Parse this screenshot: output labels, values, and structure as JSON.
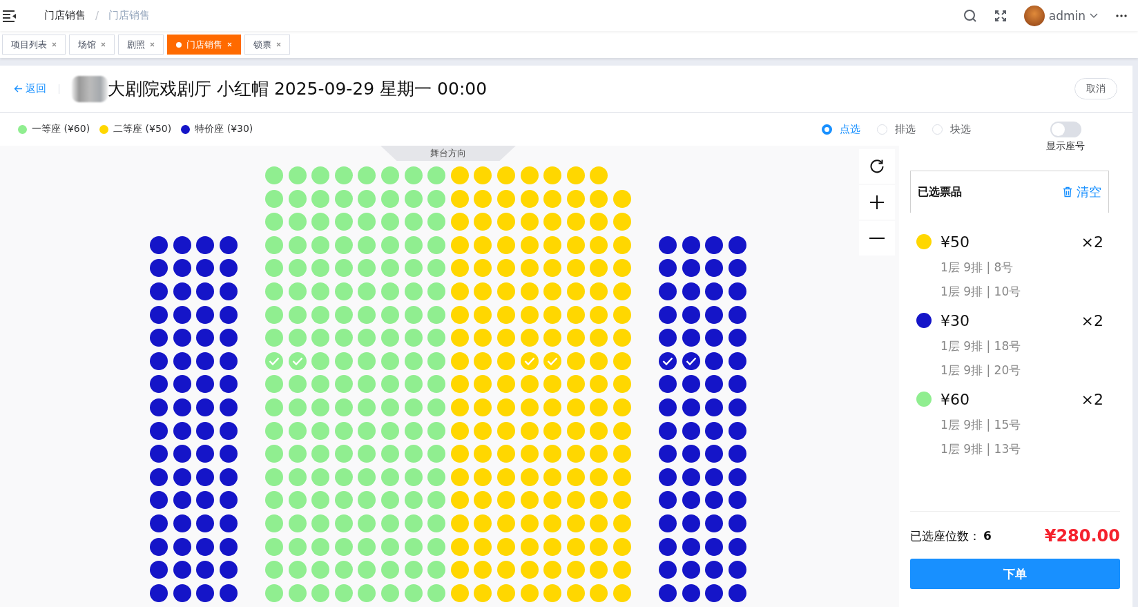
{
  "breadcrumb": {
    "separator": "/",
    "items": [
      {
        "label": "门店销售",
        "current": false
      },
      {
        "label": "门店销售",
        "current": true
      }
    ]
  },
  "user": {
    "name": "admin"
  },
  "tabs": [
    {
      "label": "项目列表",
      "selected": false
    },
    {
      "label": "场馆",
      "selected": false
    },
    {
      "label": "剧照",
      "selected": false
    },
    {
      "label": "门店销售",
      "selected": true
    },
    {
      "label": "锁票",
      "selected": false
    }
  ],
  "header": {
    "back": "返回",
    "title": "大剧院戏剧厅 小红帽 2025-09-29 星期一 00:00",
    "cancel": "取消"
  },
  "legend": [
    {
      "kind": "first",
      "label": "一等座 (¥60)",
      "color": "#90ee90"
    },
    {
      "kind": "second",
      "label": "二等座 (¥50)",
      "color": "#ffd700"
    },
    {
      "kind": "special",
      "label": "特价座 (¥30)",
      "color": "#1515c8"
    }
  ],
  "select_modes": [
    {
      "label": "点选",
      "selected": true
    },
    {
      "label": "排选",
      "selected": false
    },
    {
      "label": "块选",
      "selected": false
    }
  ],
  "show_seat_numbers": {
    "label": "显示座号",
    "on": false
  },
  "seat_map": {
    "stage": "舞台方向",
    "blocks": [
      {
        "rows": [
          {
            "groups": [
              {
                "kind": "special",
                "selected": [
                  false,
                  false,
                  false,
                  false
                ]
              }
            ]
          },
          {
            "groups": [
              {
                "kind": "special",
                "selected": [
                  false,
                  false,
                  false,
                  false
                ]
              }
            ]
          },
          {
            "groups": [
              {
                "kind": "special",
                "selected": [
                  false,
                  false,
                  false,
                  false
                ]
              }
            ]
          },
          {
            "groups": [
              {
                "kind": "special",
                "selected": [
                  false,
                  false,
                  false,
                  false
                ]
              }
            ]
          },
          {
            "groups": [
              {
                "kind": "special",
                "selected": [
                  false,
                  false,
                  false,
                  false
                ]
              }
            ]
          },
          {
            "groups": [
              {
                "kind": "special",
                "selected": [
                  false,
                  false,
                  false,
                  false
                ]
              }
            ]
          },
          {
            "groups": [
              {
                "kind": "special",
                "selected": [
                  false,
                  false,
                  false,
                  false
                ]
              }
            ]
          },
          {
            "groups": [
              {
                "kind": "special",
                "selected": [
                  false,
                  false,
                  false,
                  false
                ]
              }
            ]
          },
          {
            "groups": [
              {
                "kind": "special",
                "selected": [
                  false,
                  false,
                  false,
                  false
                ]
              }
            ]
          },
          {
            "groups": [
              {
                "kind": "special",
                "selected": [
                  false,
                  false,
                  false,
                  false
                ]
              }
            ]
          },
          {
            "groups": [
              {
                "kind": "special",
                "selected": [
                  false,
                  false,
                  false,
                  false
                ]
              }
            ]
          },
          {
            "groups": [
              {
                "kind": "special",
                "selected": [
                  false,
                  false,
                  false,
                  false
                ]
              }
            ]
          },
          {
            "groups": [
              {
                "kind": "special",
                "selected": [
                  false,
                  false,
                  false,
                  false
                ]
              }
            ]
          },
          {
            "groups": [
              {
                "kind": "special",
                "selected": [
                  false,
                  false,
                  false,
                  false
                ]
              }
            ]
          },
          {
            "groups": [
              {
                "kind": "special",
                "selected": [
                  false,
                  false,
                  false,
                  false
                ]
              }
            ]
          },
          {
            "groups": [
              {
                "kind": "special",
                "selected": [
                  false,
                  false,
                  false,
                  false
                ]
              }
            ]
          }
        ]
      },
      {
        "rows": [
          {
            "groups": [
              {
                "kind": "first",
                "selected": [
                  false,
                  false,
                  false,
                  false,
                  false,
                  false,
                  false,
                  false
                ]
              },
              {
                "kind": "second",
                "selected": [
                  false,
                  false,
                  false,
                  false,
                  false,
                  false,
                  false
                ]
              }
            ]
          },
          {
            "groups": [
              {
                "kind": "first",
                "selected": [
                  false,
                  false,
                  false,
                  false,
                  false,
                  false,
                  false,
                  false
                ]
              },
              {
                "kind": "second",
                "selected": [
                  false,
                  false,
                  false,
                  false,
                  false,
                  false,
                  false,
                  false
                ]
              }
            ]
          },
          {
            "groups": [
              {
                "kind": "first",
                "selected": [
                  false,
                  false,
                  false,
                  false,
                  false,
                  false,
                  false,
                  false
                ]
              },
              {
                "kind": "second",
                "selected": [
                  false,
                  false,
                  false,
                  false,
                  false,
                  false,
                  false,
                  false
                ]
              }
            ]
          },
          {
            "groups": [
              {
                "kind": "first",
                "selected": [
                  false,
                  false,
                  false,
                  false,
                  false,
                  false,
                  false,
                  false
                ]
              },
              {
                "kind": "second",
                "selected": [
                  false,
                  false,
                  false,
                  false,
                  false,
                  false,
                  false,
                  false
                ]
              }
            ]
          },
          {
            "groups": [
              {
                "kind": "first",
                "selected": [
                  false,
                  false,
                  false,
                  false,
                  false,
                  false,
                  false,
                  false
                ]
              },
              {
                "kind": "second",
                "selected": [
                  false,
                  false,
                  false,
                  false,
                  false,
                  false,
                  false,
                  false
                ]
              }
            ]
          },
          {
            "groups": [
              {
                "kind": "first",
                "selected": [
                  false,
                  false,
                  false,
                  false,
                  false,
                  false,
                  false,
                  false
                ]
              },
              {
                "kind": "second",
                "selected": [
                  false,
                  false,
                  false,
                  false,
                  false,
                  false,
                  false,
                  false
                ]
              }
            ]
          },
          {
            "groups": [
              {
                "kind": "first",
                "selected": [
                  false,
                  false,
                  false,
                  false,
                  false,
                  false,
                  false,
                  false
                ]
              },
              {
                "kind": "second",
                "selected": [
                  false,
                  false,
                  false,
                  false,
                  false,
                  false,
                  false,
                  false
                ]
              }
            ]
          },
          {
            "groups": [
              {
                "kind": "first",
                "selected": [
                  false,
                  false,
                  false,
                  false,
                  false,
                  false,
                  false,
                  false
                ]
              },
              {
                "kind": "second",
                "selected": [
                  false,
                  false,
                  false,
                  false,
                  false,
                  false,
                  false,
                  false
                ]
              }
            ]
          },
          {
            "groups": [
              {
                "kind": "first",
                "selected": [
                  true,
                  true,
                  false,
                  false,
                  false,
                  false,
                  false,
                  false
                ]
              },
              {
                "kind": "second",
                "selected": [
                  false,
                  false,
                  false,
                  true,
                  true,
                  false,
                  false,
                  false
                ]
              }
            ]
          },
          {
            "groups": [
              {
                "kind": "first",
                "selected": [
                  false,
                  false,
                  false,
                  false,
                  false,
                  false,
                  false,
                  false
                ]
              },
              {
                "kind": "second",
                "selected": [
                  false,
                  false,
                  false,
                  false,
                  false,
                  false,
                  false,
                  false
                ]
              }
            ]
          },
          {
            "groups": [
              {
                "kind": "first",
                "selected": [
                  false,
                  false,
                  false,
                  false,
                  false,
                  false,
                  false,
                  false
                ]
              },
              {
                "kind": "second",
                "selected": [
                  false,
                  false,
                  false,
                  false,
                  false,
                  false,
                  false,
                  false
                ]
              }
            ]
          },
          {
            "groups": [
              {
                "kind": "first",
                "selected": [
                  false,
                  false,
                  false,
                  false,
                  false,
                  false,
                  false,
                  false
                ]
              },
              {
                "kind": "second",
                "selected": [
                  false,
                  false,
                  false,
                  false,
                  false,
                  false,
                  false,
                  false
                ]
              }
            ]
          },
          {
            "groups": [
              {
                "kind": "first",
                "selected": [
                  false,
                  false,
                  false,
                  false,
                  false,
                  false,
                  false,
                  false
                ]
              },
              {
                "kind": "second",
                "selected": [
                  false,
                  false,
                  false,
                  false,
                  false,
                  false,
                  false,
                  false
                ]
              }
            ]
          },
          {
            "groups": [
              {
                "kind": "first",
                "selected": [
                  false,
                  false,
                  false,
                  false,
                  false,
                  false,
                  false,
                  false
                ]
              },
              {
                "kind": "second",
                "selected": [
                  false,
                  false,
                  false,
                  false,
                  false,
                  false,
                  false,
                  false
                ]
              }
            ]
          },
          {
            "groups": [
              {
                "kind": "first",
                "selected": [
                  false,
                  false,
                  false,
                  false,
                  false,
                  false,
                  false,
                  false
                ]
              },
              {
                "kind": "second",
                "selected": [
                  false,
                  false,
                  false,
                  false,
                  false,
                  false,
                  false,
                  false
                ]
              }
            ]
          },
          {
            "groups": [
              {
                "kind": "first",
                "selected": [
                  false,
                  false,
                  false,
                  false,
                  false,
                  false,
                  false,
                  false
                ]
              },
              {
                "kind": "second",
                "selected": [
                  false,
                  false,
                  false,
                  false,
                  false,
                  false,
                  false,
                  false
                ]
              }
            ]
          },
          {
            "groups": [
              {
                "kind": "first",
                "selected": [
                  false,
                  false,
                  false,
                  false,
                  false,
                  false,
                  false,
                  false
                ]
              },
              {
                "kind": "second",
                "selected": [
                  false,
                  false,
                  false,
                  false,
                  false,
                  false,
                  false,
                  false
                ]
              }
            ]
          },
          {
            "groups": [
              {
                "kind": "first",
                "selected": [
                  false,
                  false,
                  false,
                  false,
                  false,
                  false,
                  false,
                  false
                ]
              },
              {
                "kind": "second",
                "selected": [
                  false,
                  false,
                  false,
                  false,
                  false,
                  false,
                  false,
                  false
                ]
              }
            ]
          },
          {
            "groups": [
              {
                "kind": "first",
                "selected": [
                  false,
                  false,
                  false,
                  false,
                  false,
                  false,
                  false,
                  false
                ]
              },
              {
                "kind": "second",
                "selected": [
                  false,
                  false,
                  false,
                  false,
                  false,
                  false,
                  false,
                  false
                ]
              }
            ]
          }
        ]
      },
      {
        "rows": [
          {
            "groups": [
              {
                "kind": "special",
                "selected": [
                  false,
                  false,
                  false,
                  false
                ]
              }
            ]
          },
          {
            "groups": [
              {
                "kind": "special",
                "selected": [
                  false,
                  false,
                  false,
                  false
                ]
              }
            ]
          },
          {
            "groups": [
              {
                "kind": "special",
                "selected": [
                  false,
                  false,
                  false,
                  false
                ]
              }
            ]
          },
          {
            "groups": [
              {
                "kind": "special",
                "selected": [
                  false,
                  false,
                  false,
                  false
                ]
              }
            ]
          },
          {
            "groups": [
              {
                "kind": "special",
                "selected": [
                  false,
                  false,
                  false,
                  false
                ]
              }
            ]
          },
          {
            "groups": [
              {
                "kind": "special",
                "selected": [
                  true,
                  true,
                  false,
                  false
                ]
              }
            ]
          },
          {
            "groups": [
              {
                "kind": "special",
                "selected": [
                  false,
                  false,
                  false,
                  false
                ]
              }
            ]
          },
          {
            "groups": [
              {
                "kind": "special",
                "selected": [
                  false,
                  false,
                  false,
                  false
                ]
              }
            ]
          },
          {
            "groups": [
              {
                "kind": "special",
                "selected": [
                  false,
                  false,
                  false,
                  false
                ]
              }
            ]
          },
          {
            "groups": [
              {
                "kind": "special",
                "selected": [
                  false,
                  false,
                  false,
                  false
                ]
              }
            ]
          },
          {
            "groups": [
              {
                "kind": "special",
                "selected": [
                  false,
                  false,
                  false,
                  false
                ]
              }
            ]
          },
          {
            "groups": [
              {
                "kind": "special",
                "selected": [
                  false,
                  false,
                  false,
                  false
                ]
              }
            ]
          },
          {
            "groups": [
              {
                "kind": "special",
                "selected": [
                  false,
                  false,
                  false,
                  false
                ]
              }
            ]
          },
          {
            "groups": [
              {
                "kind": "special",
                "selected": [
                  false,
                  false,
                  false,
                  false
                ]
              }
            ]
          },
          {
            "groups": [
              {
                "kind": "special",
                "selected": [
                  false,
                  false,
                  false,
                  false
                ]
              }
            ]
          },
          {
            "groups": [
              {
                "kind": "special",
                "selected": [
                  false,
                  false,
                  false,
                  false
                ]
              }
            ]
          }
        ]
      }
    ]
  },
  "cart": {
    "title": "已选票品",
    "clear": "清空",
    "groups": [
      {
        "price": "¥50",
        "count": "×2",
        "color": "#ffd700",
        "seats": [
          "1层 9排 | 8号",
          "1层 9排 | 10号"
        ]
      },
      {
        "price": "¥30",
        "count": "×2",
        "color": "#1515c8",
        "seats": [
          "1层 9排 | 18号",
          "1层 9排 | 20号"
        ]
      },
      {
        "price": "¥60",
        "count": "×2",
        "color": "#90ee90",
        "seats": [
          "1层 9排 | 15号",
          "1层 9排 | 13号"
        ]
      }
    ],
    "count_label": "已选座位数：",
    "count": "6",
    "total": "¥280.00",
    "submit": "下单"
  }
}
